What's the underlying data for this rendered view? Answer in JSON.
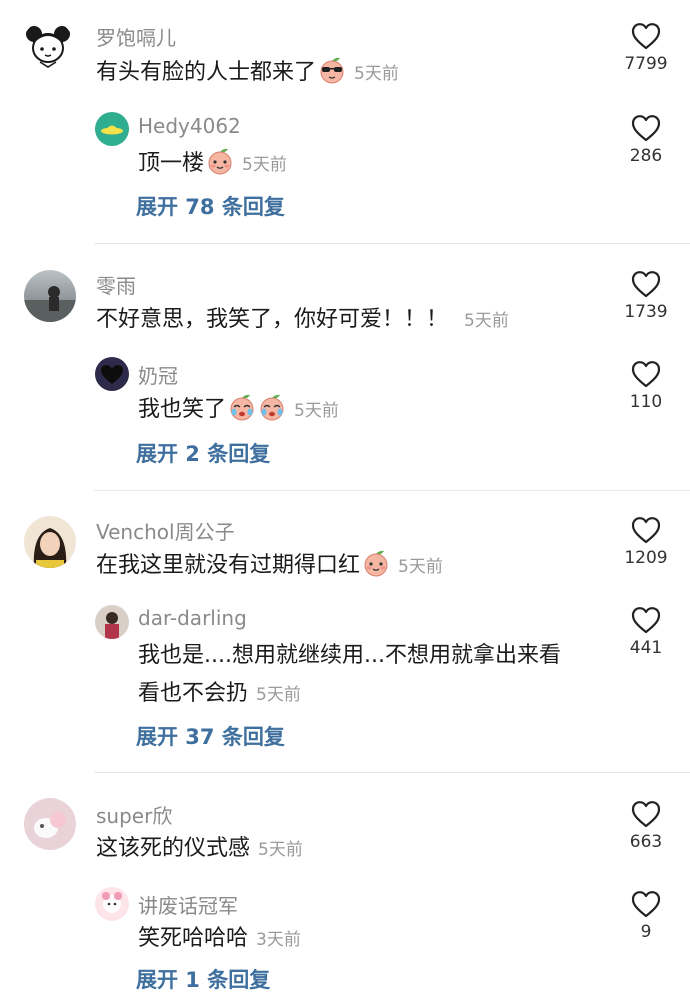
{
  "comments": [
    {
      "user": "罗饱嗝儿",
      "text": "有头有脸的人士都来了",
      "time": "5天前",
      "likes": "7799",
      "reply": {
        "user": "Hedy4062",
        "text": "顶一楼",
        "time": "5天前",
        "likes": "286"
      },
      "expand": "展开 78 条回复"
    },
    {
      "user": "零雨",
      "text": "不好意思，我笑了，你好可爱！！！",
      "time": "5天前",
      "likes": "1739",
      "reply": {
        "user": "奶冠",
        "text": "我也笑了",
        "time": "5天前",
        "likes": "110"
      },
      "expand": "展开 2 条回复"
    },
    {
      "user": "Venchol周公子",
      "text": "在我这里就没有过期得口红",
      "time": "5天前",
      "likes": "1209",
      "reply": {
        "user": "dar-darling",
        "text": "我也是....想用就继续用...不想用就拿出来看",
        "text2": "看也不会扔",
        "time": "5天前",
        "likes": "441"
      },
      "expand": "展开 37 条回复"
    },
    {
      "user": "super欣",
      "text": "这该死的仪式感",
      "time": "5天前",
      "likes": "663",
      "reply": {
        "user": "讲废话冠军",
        "text": "笑死哈哈哈",
        "time": "3天前",
        "likes": "9"
      },
      "expand": "展开 1 条回复"
    }
  ],
  "colors": {
    "link": "#3e6f9e",
    "meta": "#8a8a8a",
    "divider": "#e8e8e8"
  },
  "icons": {
    "like": "heart-outline-icon",
    "emoji": "peach-face-emoji"
  }
}
